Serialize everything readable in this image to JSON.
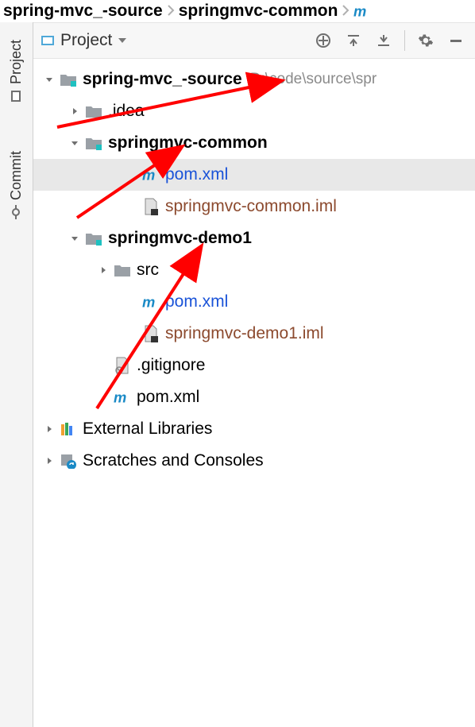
{
  "breadcrumb": {
    "item1": "spring-mvc_-source",
    "item2": "springmvc-common"
  },
  "leftStrip": {
    "tab1": "Project",
    "tab2": "Commit"
  },
  "panel": {
    "title": "Project"
  },
  "tree": {
    "root": {
      "name": "spring-mvc_-source",
      "hint": "D:\\code\\source\\spr"
    },
    "idea": ".idea",
    "common": "springmvc-common",
    "common_pom": "pom.xml",
    "common_iml": "springmvc-common.iml",
    "demo": "springmvc-demo1",
    "demo_src": "src",
    "demo_pom": "pom.xml",
    "demo_iml": "springmvc-demo1.iml",
    "gitignore": ".gitignore",
    "root_pom": "pom.xml",
    "ext": "External Libraries",
    "scratches": "Scratches and Consoles"
  }
}
